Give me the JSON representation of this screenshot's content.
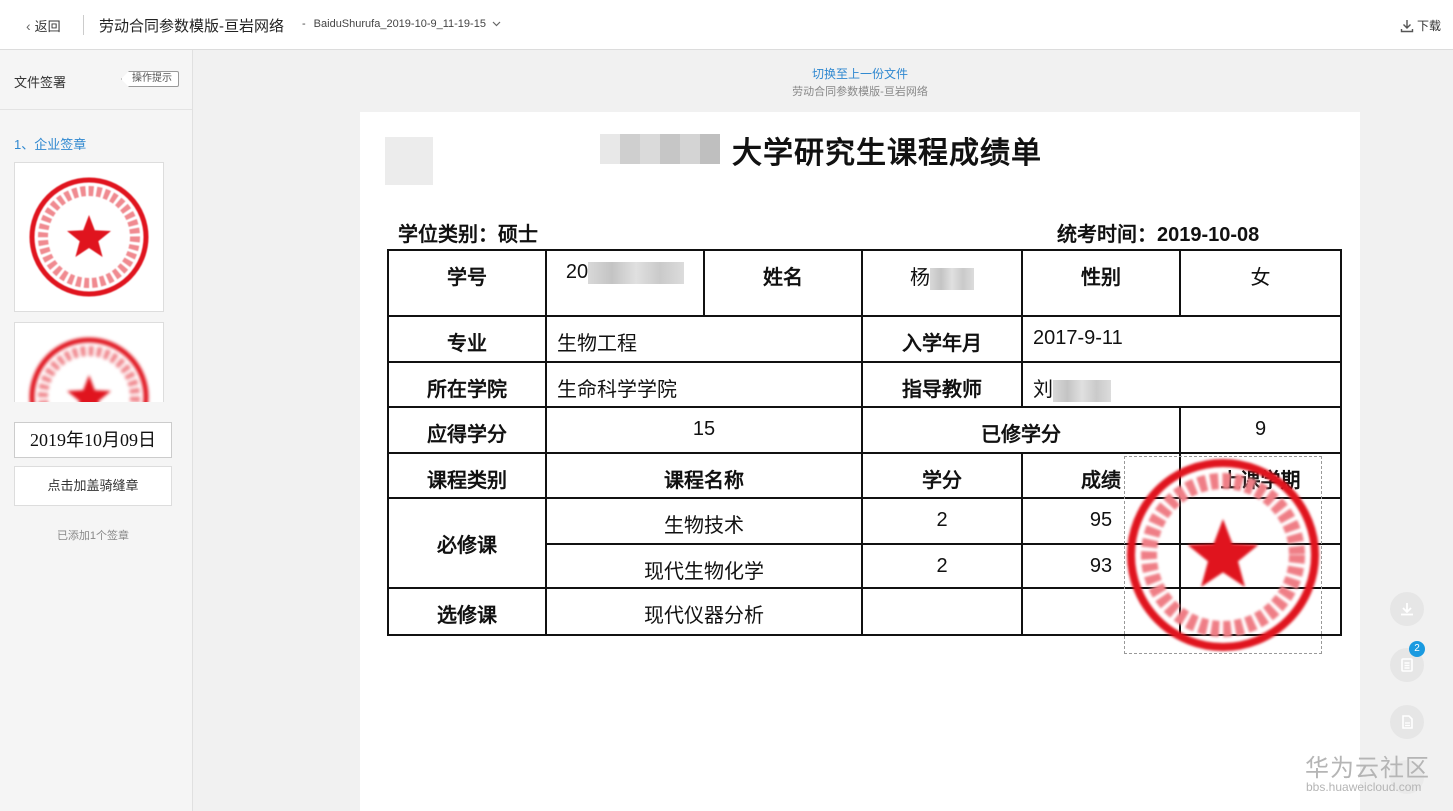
{
  "topbar": {
    "back_label": "返回",
    "doc_title": "劳动合同参数模版-亘岩网络",
    "file_name": "BaiduShurufa_2019-10-9_11-19-15",
    "download_label": "下载"
  },
  "sidebar": {
    "title": "文件签署",
    "hint_label": "操作提示",
    "section_label": "1、企业签章",
    "date_value": "2019年10月09日",
    "seam_button": "点击加盖骑缝章",
    "added_count": "已添加1个签章"
  },
  "main": {
    "switch_link": "切换至上一份文件",
    "switch_sub": "劳动合同参数模版-亘岩网络"
  },
  "paper": {
    "title": "大学研究生课程成绩单",
    "degree_label": "学位类别：硕士",
    "exam_label": "统考时间：2019-10-08",
    "rows": {
      "student_id_label": "学号",
      "student_id_prefix": "20",
      "name_label": "姓名",
      "name_prefix": "杨",
      "gender_label": "性别",
      "gender_value": "女",
      "major_label": "专业",
      "major_value": "生物工程",
      "enroll_label": "入学年月",
      "enroll_value": "2017-9-11",
      "college_label": "所在学院",
      "college_value": "生命科学学院",
      "advisor_label": "指导教师",
      "advisor_prefix": "刘",
      "required_credits_label": "应得学分",
      "required_credits_value": "15",
      "earned_credits_label": "已修学分",
      "earned_credits_value": "9"
    },
    "course_headers": [
      "课程类别",
      "课程名称",
      "学分",
      "成绩",
      "上课学期"
    ],
    "course_groups": {
      "required": "必修课",
      "elective": "选修课"
    },
    "courses": [
      {
        "name": "生物技术",
        "credit": "2",
        "score": "95"
      },
      {
        "name": "现代生物化学",
        "credit": "2",
        "score": "93"
      },
      {
        "name": "现代仪器分析",
        "credit": "",
        "score": ""
      }
    ]
  },
  "floating": {
    "badge_count": "2"
  },
  "watermark": {
    "cn": "华为云社区",
    "en": "bbs.huaweicloud.com"
  },
  "colors": {
    "accent": "#2f88d0",
    "stamp": "#e0141e",
    "badge": "#1a9ae0"
  }
}
